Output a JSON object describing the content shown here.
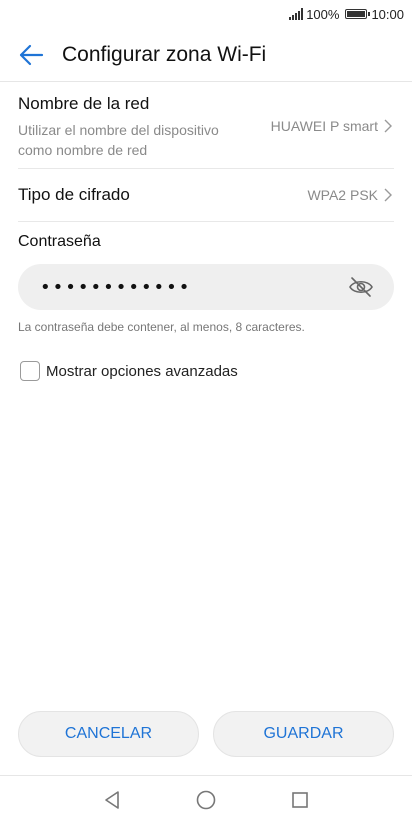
{
  "status": {
    "battery": "100%",
    "time": "10:00"
  },
  "header": {
    "title": "Configurar zona Wi-Fi"
  },
  "network_name": {
    "label": "Nombre de la red",
    "description": "Utilizar el nombre del dispositivo como nombre de red",
    "value": "HUAWEI P smart"
  },
  "encryption": {
    "label": "Tipo de cifrado",
    "value": "WPA2 PSK"
  },
  "password": {
    "label": "Contraseña",
    "value": "••••••••••••",
    "hint": "La contraseña debe contener, al menos, 8 caracteres."
  },
  "advanced": {
    "label": "Mostrar opciones avanzadas",
    "checked": false
  },
  "buttons": {
    "cancel": "CANCELAR",
    "save": "GUARDAR"
  },
  "colors": {
    "accent": "#1f74d6"
  }
}
